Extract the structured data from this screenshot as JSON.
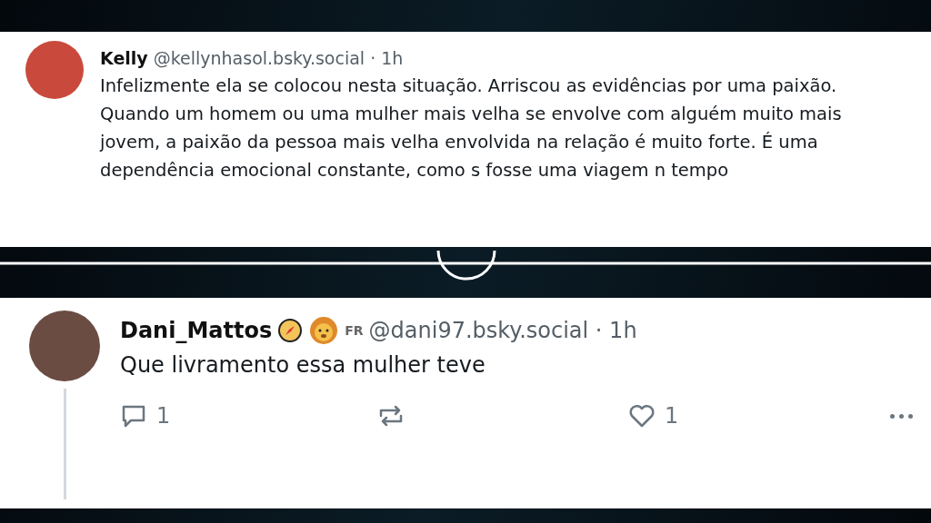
{
  "posts": [
    {
      "author": "Kelly",
      "handle": "@kellynhasol.bsky.social",
      "separator": "·",
      "time": "1h",
      "text": "Infelizmente ela se colocou nesta situação. Arriscou as evidências por uma paixão. Quando um homem ou uma mulher mais velha se envolve com alguém muito mais jovem, a paixão da pessoa mais velha envolvida na relação é muito forte. É uma dependência emocional constante, como s fosse uma viagem n tempo",
      "kind": "quoted"
    },
    {
      "author": "Dani_Mattos",
      "badge": "FR",
      "handle": "@dani97.bsky.social",
      "separator": "·",
      "time": "1h",
      "text": "Que livramento essa mulher teve",
      "kind": "reply",
      "reply_count": "1",
      "like_count": "1"
    }
  ]
}
